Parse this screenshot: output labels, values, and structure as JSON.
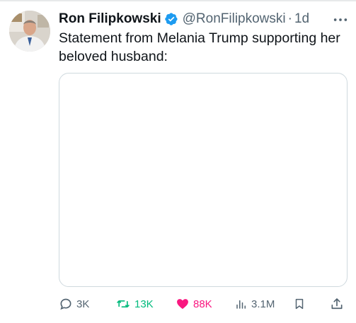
{
  "author": {
    "display_name": "Ron Filipkowski",
    "handle": "@RonFilipkowski",
    "separator": "·",
    "time": "1d",
    "verified_icon": "verified-badge-icon"
  },
  "tweet": {
    "text": "Statement from Melania Trump supporting her beloved husband:"
  },
  "actions": {
    "reply_count": "3K",
    "retweet_count": "13K",
    "like_count": "88K",
    "views_count": "3.1M"
  },
  "colors": {
    "retweet": "#00ba7c",
    "like": "#f91880",
    "verified": "#1d9bf0",
    "muted": "#536471"
  }
}
